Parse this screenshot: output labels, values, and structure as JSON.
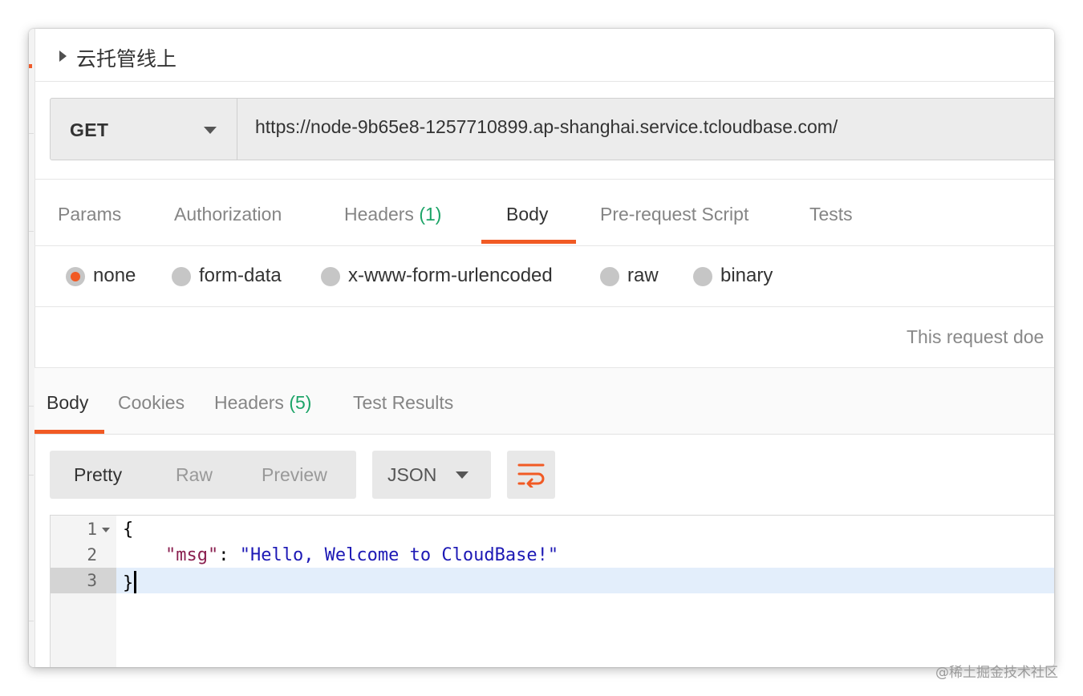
{
  "request": {
    "title": "云托管线上",
    "method": "GET",
    "url": "https://node-9b65e8-1257710899.ap-shanghai.service.tcloudbase.com/"
  },
  "request_tabs": [
    {
      "label": "Params"
    },
    {
      "label": "Authorization"
    },
    {
      "label": "Headers",
      "count": "(1)"
    },
    {
      "label": "Body",
      "active": true
    },
    {
      "label": "Pre-request Script"
    },
    {
      "label": "Tests"
    }
  ],
  "body_types": {
    "selected": "none",
    "options": [
      "none",
      "form-data",
      "x-www-form-urlencoded",
      "raw",
      "binary"
    ]
  },
  "no_body_message": "This request doe",
  "response_tabs": [
    {
      "label": "Body",
      "active": true
    },
    {
      "label": "Cookies"
    },
    {
      "label": "Headers",
      "count": "(5)"
    },
    {
      "label": "Test Results"
    }
  ],
  "response_view": {
    "modes": [
      "Pretty",
      "Raw",
      "Preview"
    ],
    "active_mode": "Pretty",
    "format": "JSON",
    "wrap_icon": "wrap-lines-icon"
  },
  "response_body": {
    "line_numbers": [
      "1",
      "2",
      "3"
    ],
    "active_line": 3,
    "open_brace": "{",
    "key": "\"msg\"",
    "colon": ": ",
    "value": "\"Hello, Welcome to CloudBase!\"",
    "close_brace": "}"
  },
  "colors": {
    "accent": "#f15a24",
    "count_green": "#1da468",
    "json_key": "#8a1f4f",
    "json_string": "#1d19b5",
    "active_line_bg": "#e3eefb"
  },
  "watermark": "@稀土掘金技术社区"
}
